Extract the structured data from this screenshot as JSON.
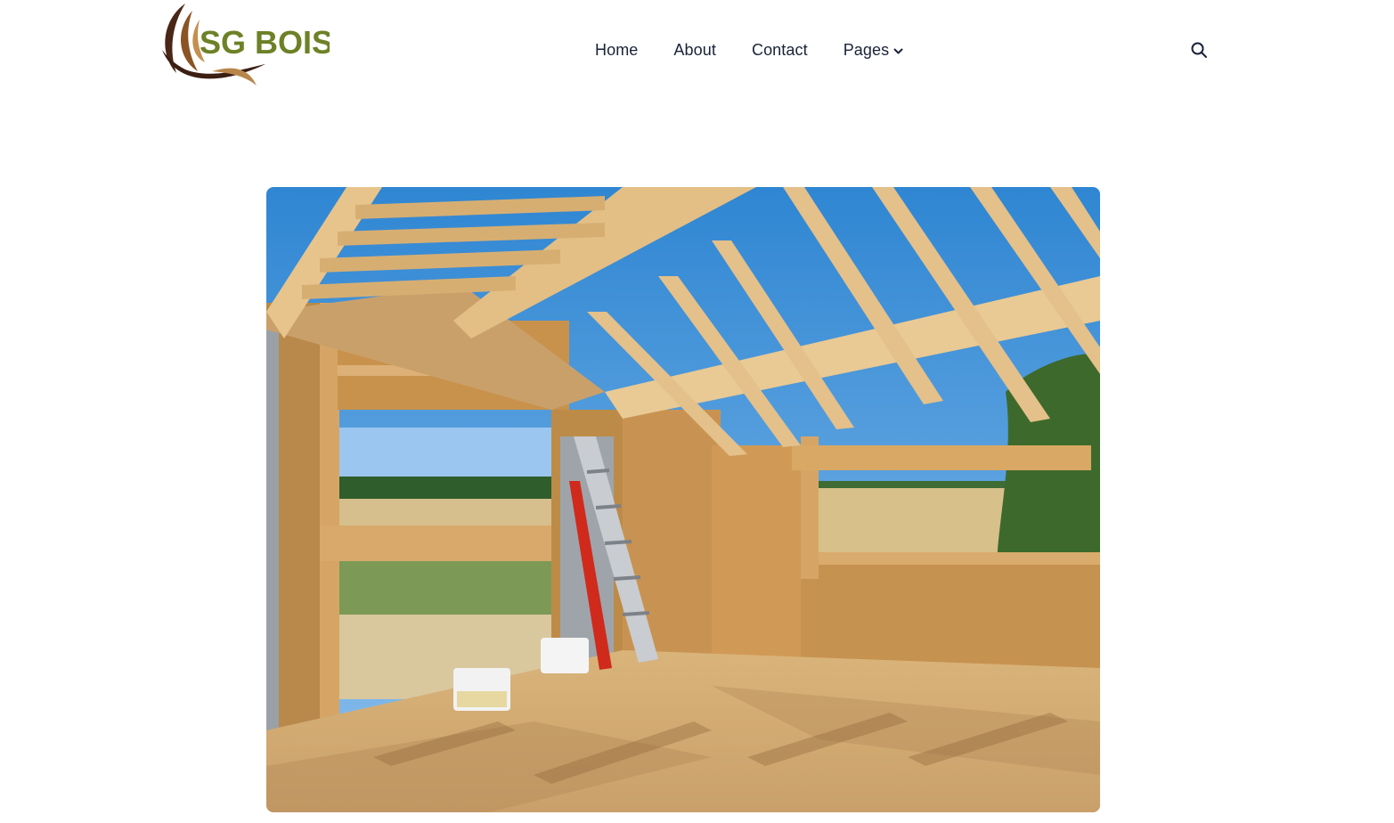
{
  "brand": {
    "name": "SG BOIS",
    "colors": {
      "text_green": "#6d8127",
      "swoosh_dark": "#3b1f12",
      "swoosh_mid": "#7a4a22",
      "swoosh_light": "#b8864b"
    }
  },
  "nav": {
    "items": [
      {
        "label": "Home"
      },
      {
        "label": "About"
      },
      {
        "label": "Contact"
      },
      {
        "label": "Pages",
        "has_dropdown": true,
        "icon": "chevron-down-icon"
      }
    ]
  },
  "header_actions": {
    "search_icon": "search-icon"
  },
  "hero": {
    "subject": "timber frame house under construction with open roof rafters, ladder, paint buckets, fields and trees outside",
    "colors": {
      "sky": "#3a8ed4",
      "wood": "#e2b878",
      "osb": "#c9964f",
      "field": "#d8c08a"
    }
  }
}
